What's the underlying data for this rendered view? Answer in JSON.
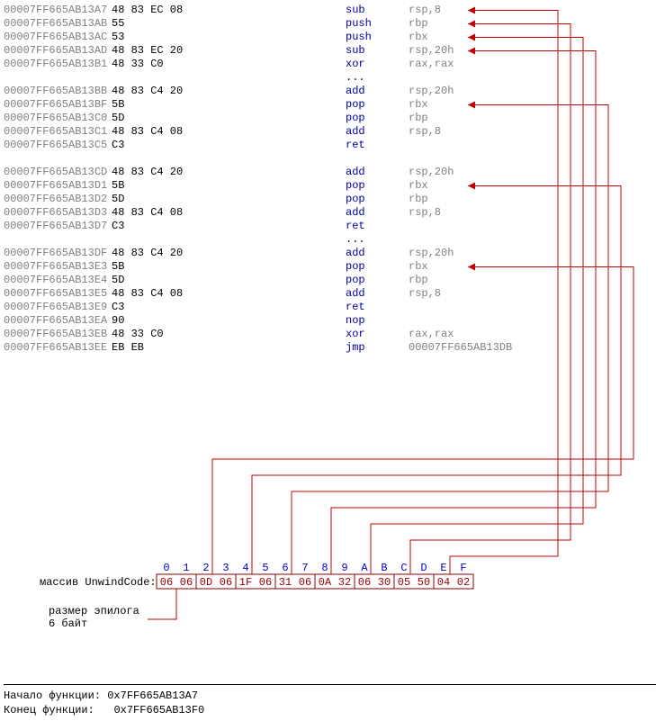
{
  "disasm": [
    {
      "addr": "00007FF665AB13A7",
      "bytes": "48 83 EC 08",
      "mnem": "sub",
      "oper": "rsp,8"
    },
    {
      "addr": "00007FF665AB13AB",
      "bytes": "55",
      "mnem": "push",
      "oper": "rbp"
    },
    {
      "addr": "00007FF665AB13AC",
      "bytes": "53",
      "mnem": "push",
      "oper": "rbx"
    },
    {
      "addr": "00007FF665AB13AD",
      "bytes": "48 83 EC 20",
      "mnem": "sub",
      "oper": "rsp,20h"
    },
    {
      "addr": "00007FF665AB13B1",
      "bytes": "48 33 C0",
      "mnem": "xor",
      "oper": "rax,rax"
    },
    {
      "dots": true
    },
    {
      "addr": "00007FF665AB13BB",
      "bytes": "48 83 C4 20",
      "mnem": "add",
      "oper": "rsp,20h"
    },
    {
      "addr": "00007FF665AB13BF",
      "bytes": "5B",
      "mnem": "pop",
      "oper": "rbx"
    },
    {
      "addr": "00007FF665AB13C0",
      "bytes": "5D",
      "mnem": "pop",
      "oper": "rbp"
    },
    {
      "addr": "00007FF665AB13C1",
      "bytes": "48 83 C4 08",
      "mnem": "add",
      "oper": "rsp,8"
    },
    {
      "addr": "00007FF665AB13C5",
      "bytes": "C3",
      "mnem": "ret",
      "oper": ""
    },
    {
      "gap": true
    },
    {
      "addr": "00007FF665AB13CD",
      "bytes": "48 83 C4 20",
      "mnem": "add",
      "oper": "rsp,20h"
    },
    {
      "addr": "00007FF665AB13D1",
      "bytes": "5B",
      "mnem": "pop",
      "oper": "rbx"
    },
    {
      "addr": "00007FF665AB13D2",
      "bytes": "5D",
      "mnem": "pop",
      "oper": "rbp"
    },
    {
      "addr": "00007FF665AB13D3",
      "bytes": "48 83 C4 08",
      "mnem": "add",
      "oper": "rsp,8"
    },
    {
      "addr": "00007FF665AB13D7",
      "bytes": "C3",
      "mnem": "ret",
      "oper": ""
    },
    {
      "dots": true
    },
    {
      "addr": "00007FF665AB13DF",
      "bytes": "48 83 C4 20",
      "mnem": "add",
      "oper": "rsp,20h"
    },
    {
      "addr": "00007FF665AB13E3",
      "bytes": "5B",
      "mnem": "pop",
      "oper": "rbx"
    },
    {
      "addr": "00007FF665AB13E4",
      "bytes": "5D",
      "mnem": "pop",
      "oper": "rbp"
    },
    {
      "addr": "00007FF665AB13E5",
      "bytes": "48 83 C4 08",
      "mnem": "add",
      "oper": "rsp,8"
    },
    {
      "addr": "00007FF665AB13E9",
      "bytes": "C3",
      "mnem": "ret",
      "oper": ""
    },
    {
      "addr": "00007FF665AB13EA",
      "bytes": "90",
      "mnem": "nop",
      "oper": ""
    },
    {
      "addr": "00007FF665AB13EB",
      "bytes": "48 33 C0",
      "mnem": "xor",
      "oper": "rax,rax"
    },
    {
      "addr": "00007FF665AB13EE",
      "bytes": "EB EB",
      "mnem": "jmp",
      "oper": "00007FF665AB13DB"
    }
  ],
  "unwind": {
    "label": "массив UnwindCode:",
    "indices": [
      "0",
      "1",
      "2",
      "3",
      "4",
      "5",
      "6",
      "7",
      "8",
      "9",
      "A",
      "B",
      "C",
      "D",
      "E",
      "F"
    ],
    "bytes": [
      "06",
      "06",
      "0D",
      "06",
      "1F",
      "06",
      "31",
      "06",
      "0A",
      "32",
      "06",
      "30",
      "05",
      "50",
      "04",
      "02"
    ],
    "groups": [
      {
        "start": 0,
        "end": 1
      },
      {
        "start": 2,
        "end": 3
      },
      {
        "start": 4,
        "end": 5
      },
      {
        "start": 6,
        "end": 7
      },
      {
        "start": 8,
        "end": 9
      },
      {
        "start": 10,
        "end": 11
      },
      {
        "start": 12,
        "end": 13
      },
      {
        "start": 14,
        "end": 15
      }
    ],
    "epilog_label1": "размер эпилога",
    "epilog_label2": "6 байт"
  },
  "arrows": [
    {
      "group": 7,
      "row": 0
    },
    {
      "group": 6,
      "row": 1
    },
    {
      "group": 5,
      "row": 2
    },
    {
      "group": 4,
      "row": 3
    },
    {
      "group": 3,
      "row": 7
    },
    {
      "group": 2,
      "row": 13
    },
    {
      "group": 1,
      "row": 19
    }
  ],
  "epilog_arrow": {
    "group": 0
  },
  "footer": {
    "func_start_label": "Начало функции:",
    "func_start_value": "0x7FF665AB13A7",
    "func_end_label": "Конец функции:",
    "func_end_value": "0x7FF665AB13F0"
  },
  "chart_data": {
    "type": "table",
    "title": "UnwindCode array mapping to prolog/epilog instructions",
    "unwind_bytes_hex": [
      "06",
      "06",
      "0D",
      "06",
      "1F",
      "06",
      "31",
      "06",
      "0A",
      "32",
      "06",
      "30",
      "05",
      "50",
      "04",
      "02"
    ],
    "mappings": [
      {
        "unwind_pair": "04 02",
        "target_instruction": "sub rsp,8",
        "target_address": "00007FF665AB13A7"
      },
      {
        "unwind_pair": "05 50",
        "target_instruction": "push rbp",
        "target_address": "00007FF665AB13AB"
      },
      {
        "unwind_pair": "06 30",
        "target_instruction": "push rbx",
        "target_address": "00007FF665AB13AC"
      },
      {
        "unwind_pair": "0A 32",
        "target_instruction": "sub rsp,20h",
        "target_address": "00007FF665AB13AD"
      },
      {
        "unwind_pair": "31 06",
        "target_instruction": "pop rbx (epilog 1)",
        "target_address": "00007FF665AB13BF"
      },
      {
        "unwind_pair": "1F 06",
        "target_instruction": "pop rbx (epilog 2)",
        "target_address": "00007FF665AB13D1"
      },
      {
        "unwind_pair": "0D 06",
        "target_instruction": "pop rbx (epilog 3)",
        "target_address": "00007FF665AB13E3"
      },
      {
        "unwind_pair": "06 06",
        "meaning": "размер эпилога 6 байт"
      }
    ],
    "function_start": "0x7FF665AB13A7",
    "function_end": "0x7FF665AB13F0"
  }
}
